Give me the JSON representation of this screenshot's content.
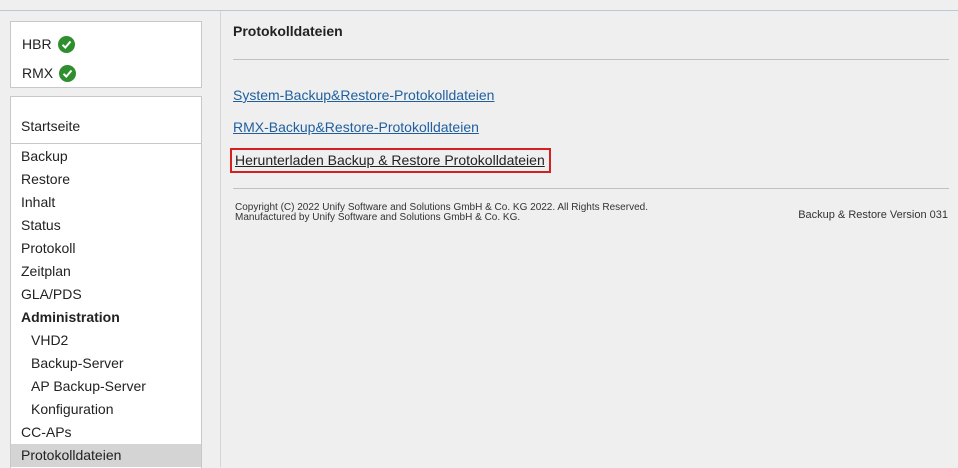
{
  "status": {
    "items": [
      {
        "label": "HBR",
        "state": "ok",
        "icon": "check-circle-icon"
      },
      {
        "label": "RMX",
        "state": "ok",
        "icon": "check-circle-icon"
      }
    ],
    "ok_color": "#2f8f2f"
  },
  "sidebar": {
    "home": "Startseite",
    "items": [
      {
        "label": "Backup"
      },
      {
        "label": "Restore"
      },
      {
        "label": "Inhalt"
      },
      {
        "label": "Status"
      },
      {
        "label": "Protokoll"
      },
      {
        "label": "Zeitplan"
      },
      {
        "label": "GLA/PDS"
      },
      {
        "label": "Administration"
      },
      {
        "label": "VHD2"
      },
      {
        "label": "Backup-Server"
      },
      {
        "label": "AP Backup-Server"
      },
      {
        "label": "Konfiguration"
      },
      {
        "label": "CC-APs"
      },
      {
        "label": "Protokolldateien"
      }
    ]
  },
  "main": {
    "title": "Protokolldateien",
    "links": [
      "System-Backup&Restore-Protokolldateien",
      "RMX-Backup&Restore-Protokolldateien",
      "Herunterladen Backup & Restore Protokolldateien"
    ],
    "footer": {
      "copyright_line1": "Copyright (C) 2022 Unify Software and Solutions GmbH & Co. KG 2022. All Rights Reserved.",
      "copyright_line2": "Manufactured by Unify Software and Solutions GmbH & Co. KG.",
      "version": "Backup & Restore Version 031"
    }
  },
  "colors": {
    "link": "#1f5f9f",
    "highlight_border": "#d42020",
    "active_item_bg": "#d4d4d4"
  }
}
